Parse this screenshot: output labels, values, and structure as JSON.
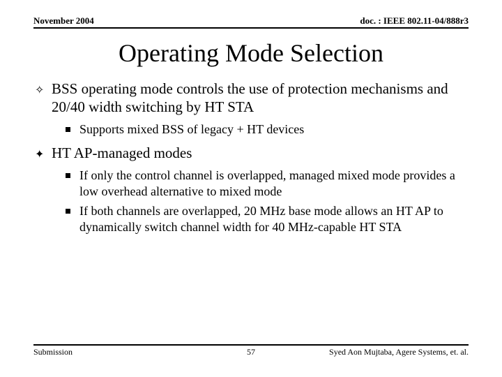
{
  "header": {
    "left": "November 2004",
    "right": "doc. : IEEE 802.11-04/888r3"
  },
  "title": "Operating Mode Selection",
  "bullets": [
    {
      "style": "open",
      "text": "BSS operating mode controls the use of protection mechanisms and 20/40 width switching by HT STA",
      "sub": [
        "Supports mixed BSS of legacy + HT devices"
      ]
    },
    {
      "style": "solid",
      "text": "HT AP-managed modes",
      "sub": [
        "If only the control channel is overlapped,  managed mixed mode provides a low overhead alternative to mixed mode",
        "If both channels are overlapped, 20 MHz base mode allows an HT AP to dynamically switch channel width for 40 MHz-capable HT STA"
      ]
    }
  ],
  "footer": {
    "left": "Submission",
    "center": "57",
    "right": "Syed Aon Mujtaba, Agere Systems, et. al."
  }
}
